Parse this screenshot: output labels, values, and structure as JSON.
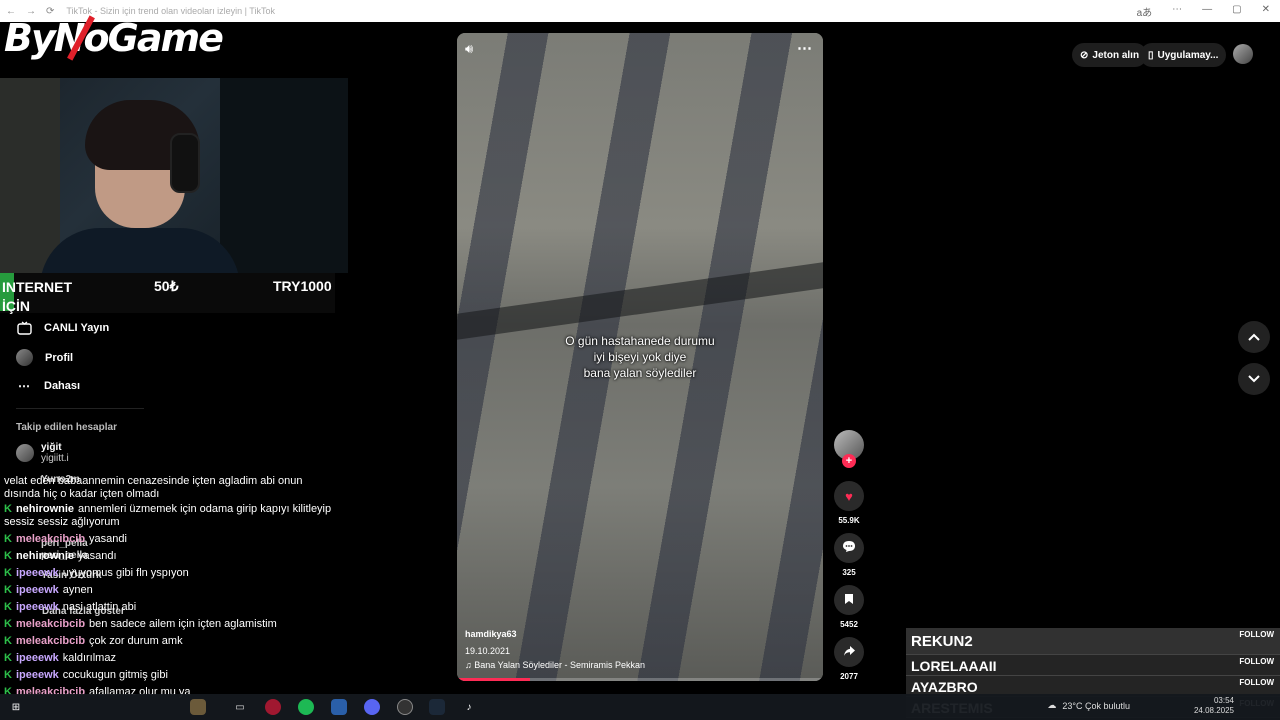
{
  "browser": {
    "page_title": "TikTok - Sizin için trend olan videoları izleyin | TikTok",
    "translate_label": "aあ"
  },
  "overlay": {
    "logo": "ByNoGame",
    "donation": {
      "text_line1": "INTERNET",
      "text_line2": "İÇİN",
      "amount": "50₺",
      "total": "TRY1000"
    }
  },
  "sidebar": {
    "items": [
      {
        "label": "CANLI Yayın",
        "icon": "live-tv-icon"
      },
      {
        "label": "Profil",
        "icon": "avatar"
      },
      {
        "label": "Dahası",
        "icon": "more-icon"
      }
    ],
    "followed_title": "Takip edilen hesaplar",
    "followed": [
      {
        "name": "yiğit",
        "handle": "yigiitt.i"
      }
    ],
    "ghost_texts": [
      "Yuno2m",
      "peri_pella",
      "peri_pella",
      "Yasin Öztürk",
      "Daha fazla göster"
    ]
  },
  "chat": {
    "lines": [
      {
        "text": "velat eden babaannemin cenazesinde içten agladim abi onun dısında hiç o kadar içten olmadı",
        "wrap": true
      },
      {
        "user": "nehirownie",
        "user_color": "#ffffff",
        "message": "annemleri üzmemek için odama girip kapıyı kilitleyip sessiz sessiz ağlıyorum",
        "wrap": true
      },
      {
        "user": "meleakcibcib",
        "user_color": "#e8a0c8",
        "message": "yasandi"
      },
      {
        "user": "nehirownie",
        "user_color": "#ffffff",
        "message": "yasandı"
      },
      {
        "user": "ipeeewk",
        "user_color": "#c8a8ff",
        "message": "uyuyomus gibi fln yspıyon"
      },
      {
        "user": "ipeeewk",
        "user_color": "#c8a8ff",
        "message": "aynen"
      },
      {
        "user": "ipeeewk",
        "user_color": "#c8a8ff",
        "message": "nasi atlattin abi"
      },
      {
        "user": "meleakcibcib",
        "user_color": "#e8a0c8",
        "message": "ben sadece ailem için içten aglamistim"
      },
      {
        "user": "meleakcibcib",
        "user_color": "#e8a0c8",
        "message": "çok zor durum amk"
      },
      {
        "user": "ipeeewk",
        "user_color": "#c8a8ff",
        "message": "kaldırılmaz"
      },
      {
        "user": "ipeeewk",
        "user_color": "#c8a8ff",
        "message": "cocukugun gitmiş gibi"
      },
      {
        "user": "meleakcibcib",
        "user_color": "#e8a0c8",
        "message": "afallamaz olur mu ya"
      }
    ]
  },
  "video": {
    "caption_lines": [
      "O gün hastahanede durumu",
      "iyi bişeyi yok diye",
      "bana yalan söylediler"
    ],
    "author": "hamdikya63",
    "date": "19.10.2021",
    "music": "Bana Yalan Söylediler - Semiramis Pekkan",
    "progress": 0.2
  },
  "actions": {
    "likes": "55.9K",
    "comments": "325",
    "saves": "5452",
    "shares": "2077"
  },
  "header": {
    "coins": "Jeton alın",
    "app": "Uygulamay..."
  },
  "followers_overlay": [
    {
      "name": "REKUN2",
      "tag": "FOLLOW"
    },
    {
      "name": "LORELAAAII",
      "tag": "FOLLOW"
    },
    {
      "name": "AYAZBRO",
      "tag": "FOLLOW"
    },
    {
      "name": "ARESTEMIS",
      "tag": "FOLLOW"
    }
  ],
  "taskbar": {
    "weather": "23°C  Çok bulutlu",
    "time": "03:54",
    "date": "24.08.2025"
  }
}
